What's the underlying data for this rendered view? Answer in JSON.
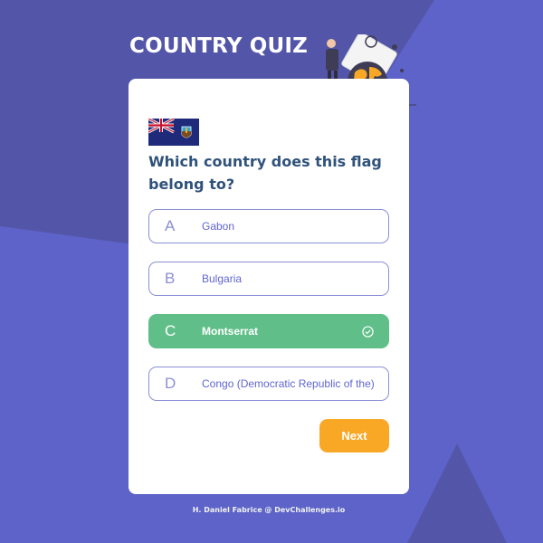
{
  "colors": {
    "background": "#5356a8",
    "background_light": "#5d63c8",
    "title": "#ffffff",
    "question": "#2f527b",
    "option_border": "#8b8fd6",
    "option_text": "#6066d0",
    "correct": "#60bf88",
    "next_button": "#f9a826"
  },
  "app": {
    "title": "COUNTRY QUIZ"
  },
  "quiz": {
    "flag_icon": "montserrat-flag-icon",
    "question": "Which country does this flag belong to?",
    "options": [
      {
        "letter": "A",
        "text": "Gabon",
        "state": "default"
      },
      {
        "letter": "B",
        "text": "Bulgaria",
        "state": "default"
      },
      {
        "letter": "C",
        "text": "Montserrat",
        "state": "correct"
      },
      {
        "letter": "D",
        "text": "Congo (Democratic Republic of the)",
        "state": "default"
      }
    ],
    "next_label": "Next"
  },
  "footer": {
    "credit": "H. Daniel Fabrice @ DevChallenges.io"
  }
}
